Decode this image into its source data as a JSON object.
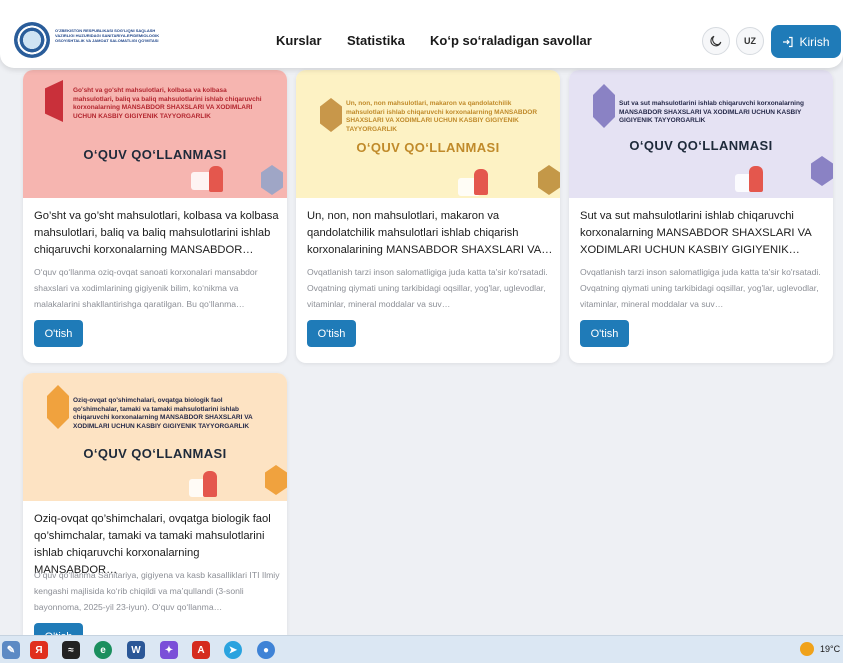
{
  "header": {
    "logo_text": "O'zbekiston Respublikasi Sog'liqni saqlash vazirligi huzuridagi Sanitariya-epidemiologik osoyishtalik va jamoat salomatligi qo'mitasi",
    "nav": [
      "Kurslar",
      "Statistika",
      "Ko‘p so‘raladigan savollar"
    ],
    "lang": "UZ",
    "login_label": "Kirish"
  },
  "cards": [
    {
      "banner_text": "Go'sht va go'sht mahsulotlari, kolbasa va kolbasa mahsulotlari, baliq va baliq mahsulotlarini ishlab chiqaruvchi korxonalarning MANSABDOR SHAXSLARI VA XODIMLARI UCHUN KASBIY GIGIYENIK TAYYORGARLIK",
      "banner_title": "O‘QUV QO‘LLANMASI",
      "title": "Go’sht va go’sht mahsulotlari, kolbasa va kolbasa mahsulotlari, baliq va baliq mahsulotlarini ishlab chiqaruvchi korxonalarning MANSABDOR…",
      "description": "O‘quv qo‘llanma oziq-ovqat sanoati korxonalari mansabdor shaxslari va xodimlarining gigiyenik bilim, ko‘nikma va malakalarini shakllantirishga qaratilgan. Bu qo‘llanma…",
      "button": "O'tish",
      "bg": "#f6b5b0",
      "accent": "#c9303a",
      "text_color": "#b3262f"
    },
    {
      "banner_text": "Un, non, non mahsulotlari, makaron va qandolatchilik mahsulotlari ishlab chiqaruvchi korxonalarning MANSABDOR SHAXSLARI VA XODIMLARI UCHUN KASBIY GIGIYENIK TAYYORGARLIK",
      "banner_title": "O‘QUV QO‘LLANMASI",
      "title": "Un, non, non mahsulotlari, makaron va qandolatchilik mahsulotlari ishlab chiqarish korxonalarining MANSABDOR SHAXSLARI VA…",
      "description": "Ovqatlanish tarzi inson salomatligiga juda katta ta'sir ko'rsatadi. Ovqatning qiymati uning tarkibidagi oqsillar, yog'lar, uglevodlar, vitaminlar, mineral moddalar va suv…",
      "button": "O'tish",
      "bg": "#fdf2c4",
      "accent": "#d7a64b",
      "text_color": "#c08a2a"
    },
    {
      "banner_text": "Sut va sut mahsulotlarini ishlab chiqaruvchi korxonalarning MANSABDOR SHAXSLARI VA XODIMLARI UCHUN KASBIY GIGIYENIK TAYYORGARLIK",
      "banner_title": "O‘QUV QO‘LLANMASI",
      "title": "Sut va sut mahsulotlarini ishlab chiqaruvchi korxonalarning MANSABDOR SHAXSLARI VA XODIMLARI UCHUN KASBIY GIGIYENIK…",
      "description": "Ovqatlanish tarzi inson salomatligiga juda katta ta'sir ko'rsatadi. Ovqatning qiymati uning tarkibidagi oqsillar, yog'lar, uglevodlar, vitaminlar, mineral moddalar va suv…",
      "button": "O'tish",
      "bg": "#e5e2f3",
      "accent": "#8a82c4",
      "text_color": "#262a4a"
    },
    {
      "banner_text": "Oziq-ovqat qo'shimchalari, ovqatga biologik faol qo'shimchalar, tamaki va tamaki mahsulotlarini ishlab chiqaruvchi korxonalarning MANSABDOR SHAXSLARI VA XODIMLARI UCHUN KASBIY GIGIYENIK TAYYORGARLIK",
      "banner_title": "O‘QUV QO‘LLANMASI",
      "title": "Oziq-ovqat qo’shimchalari, ovqatga biologik faol qo’shimchalar, tamaki va tamaki mahsulotlarini ishlab chiqaruvchi korxonalarning MANSABDOR…",
      "description": "O‘quv qo‘llanma Sanitariya, gigiyena va kasb kasalliklari ITI Ilmiy kengashi majlisida ko‘rib chiqildi va ma’qullandi (3-sonli bayonnoma, 2025-yil 23-iyun). O‘quv qo‘llanma…",
      "button": "O'tish",
      "bg": "#fde3c3",
      "accent": "#f0a23e",
      "text_color": "#262a4a"
    }
  ],
  "taskbar": {
    "temperature": "19°C"
  }
}
